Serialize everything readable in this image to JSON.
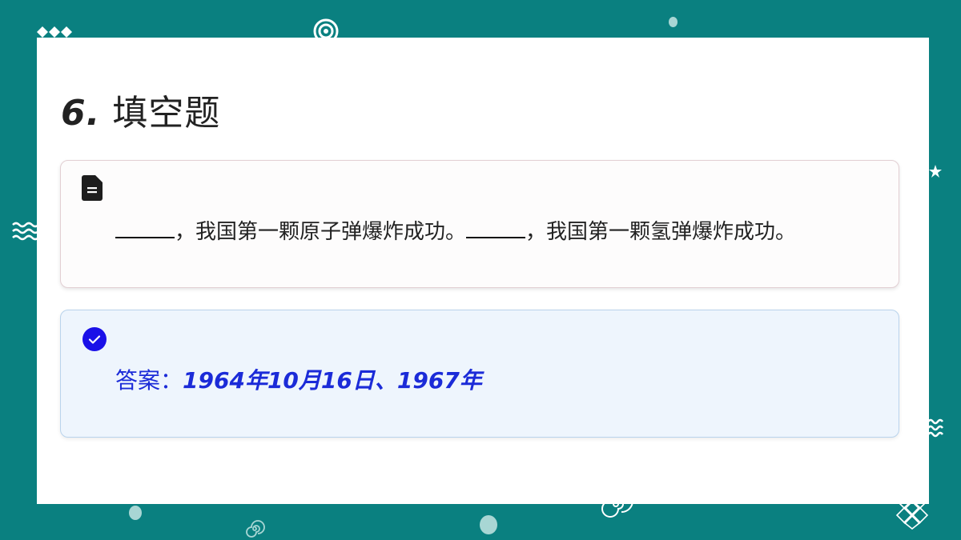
{
  "slide": {
    "title_number": "6.",
    "title_text": "填空题"
  },
  "question": {
    "icon": "document-icon",
    "part1": "，我国第一颗原子弹爆炸成功。",
    "part2": "，我国第一颗氢弹爆炸成功。"
  },
  "answer": {
    "icon": "check-circle-icon",
    "label": "答案：",
    "value": "1964年10月16日、1967年"
  },
  "colors": {
    "background": "#0a8080",
    "answer_text": "#1b2bd8",
    "check_circle": "#1a10e8"
  }
}
